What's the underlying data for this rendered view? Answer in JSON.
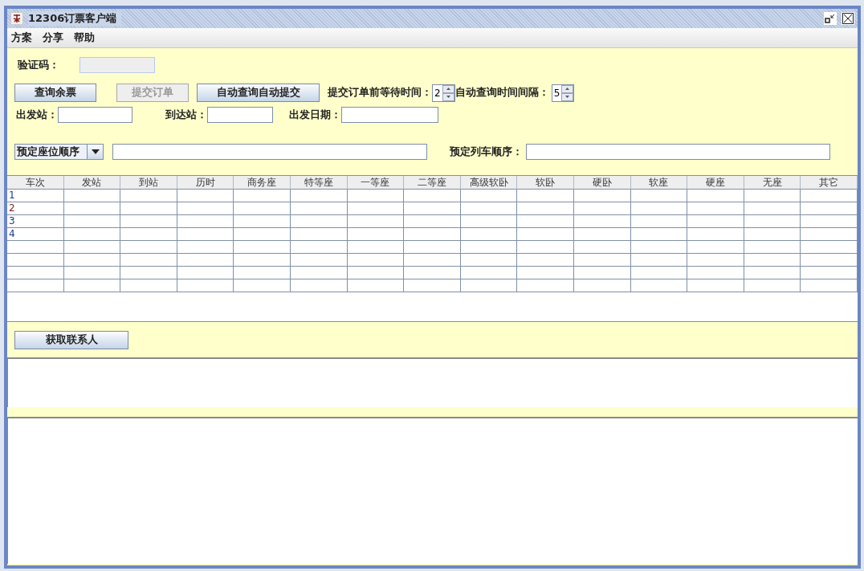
{
  "window": {
    "title": "12306订票客户端"
  },
  "menu": [
    "方案",
    "分享",
    "帮助"
  ],
  "captcha": {
    "label": "验证码："
  },
  "buttons": [
    {
      "label": "查询余票",
      "disabled": false
    },
    {
      "label": "提交订单",
      "disabled": true
    },
    {
      "label": "自动查询自动提交",
      "disabled": false
    }
  ],
  "wait_time": {
    "label": "提交订单前等待时间：",
    "value": "2"
  },
  "interval": {
    "label": "自动查询时间间隔：",
    "value": "5"
  },
  "stations": [
    {
      "label": "出发站："
    },
    {
      "label": "到达站："
    },
    {
      "label": "出发日期："
    }
  ],
  "seat_order": {
    "value": "预定座位顺序"
  },
  "train_order": {
    "label": "预定列车顺序："
  },
  "table": {
    "columns": [
      "车次",
      "发站",
      "到站",
      "历时",
      "商务座",
      "特等座",
      "一等座",
      "二等座",
      "高级软卧",
      "软卧",
      "硬卧",
      "软座",
      "硬座",
      "无座",
      "其它"
    ],
    "rows": [
      {
        "number": "1"
      },
      {
        "number": "2"
      },
      {
        "number": "3"
      },
      {
        "number": "4"
      }
    ]
  },
  "contacts_button": {
    "label": "获取联系人"
  }
}
